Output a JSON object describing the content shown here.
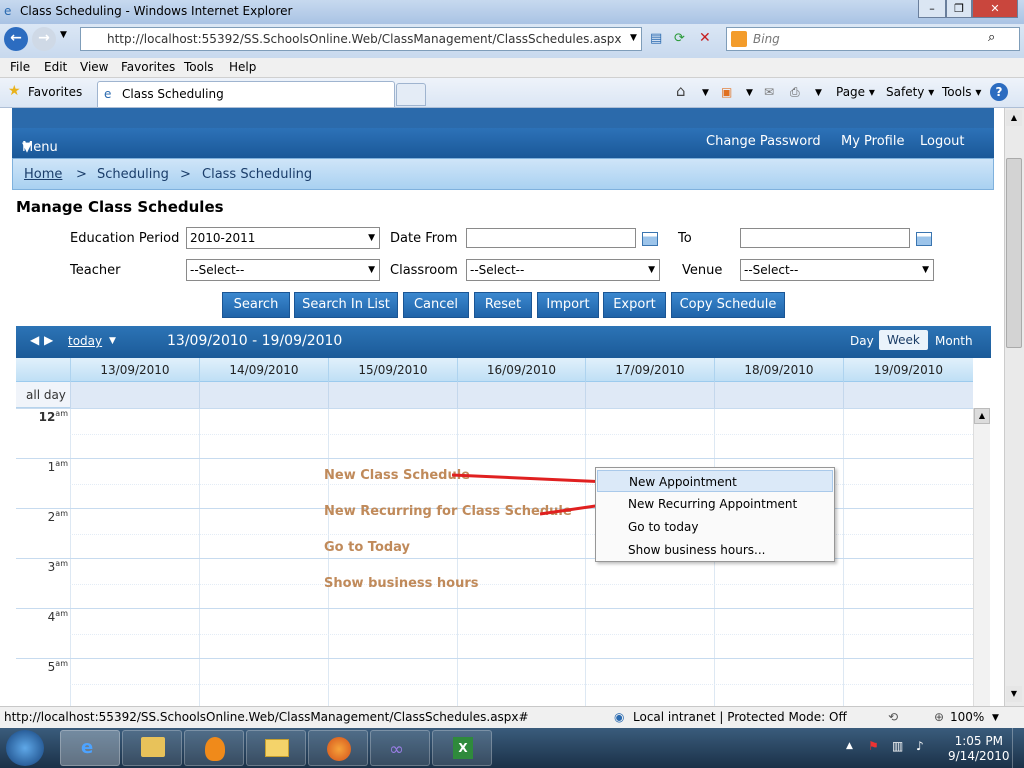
{
  "window": {
    "title": "Class Scheduling - Windows Internet Explorer"
  },
  "browser": {
    "address": "http://localhost:55392/SS.SchoolsOnline.Web/ClassManagement/ClassSchedules.aspx",
    "search_placeholder": "Bing",
    "menu": [
      "File",
      "Edit",
      "View",
      "Favorites",
      "Tools",
      "Help"
    ],
    "favorites_label": "Favorites",
    "tab_title": "Class Scheduling",
    "commands": {
      "page": "Page",
      "safety": "Safety",
      "tools": "Tools"
    }
  },
  "app": {
    "menu_label": "Menu",
    "links": {
      "change_password": "Change Password",
      "my_profile": "My Profile",
      "logout": "Logout"
    },
    "breadcrumb": {
      "home": "Home",
      "sep": ">",
      "scheduling": "Scheduling",
      "current": "Class Scheduling"
    },
    "heading": "Manage Class Schedules"
  },
  "filters": {
    "education_period_label": "Education Period",
    "education_period_value": "2010-2011",
    "date_from_label": "Date From",
    "to_label": "To",
    "teacher_label": "Teacher",
    "teacher_value": "--Select--",
    "classroom_label": "Classroom",
    "classroom_value": "--Select--",
    "venue_label": "Venue",
    "venue_value": "--Select--"
  },
  "buttons": [
    "Search",
    "Search In List",
    "Cancel",
    "Reset",
    "Import",
    "Export",
    "Copy Schedule"
  ],
  "scheduler": {
    "today": "today",
    "range": "13/09/2010 - 19/09/2010",
    "views": {
      "day": "Day",
      "week": "Week",
      "month": "Month"
    },
    "days": [
      "13/09/2010",
      "14/09/2010",
      "15/09/2010",
      "16/09/2010",
      "17/09/2010",
      "18/09/2010",
      "19/09/2010"
    ],
    "all_day": "all day",
    "hours": [
      "12",
      "1",
      "2",
      "3",
      "4",
      "5"
    ],
    "am": "am"
  },
  "annotations": [
    "New Class Schedule",
    "New Recurring for Class Schedule",
    "Go to Today",
    "Show business hours"
  ],
  "context_menu": [
    "New Appointment",
    "New Recurring Appointment",
    "Go to today",
    "Show business hours..."
  ],
  "status": {
    "url": "http://localhost:55392/SS.SchoolsOnline.Web/ClassManagement/ClassSchedules.aspx#",
    "zone": "Local intranet | Protected Mode: Off",
    "zoom": "100%"
  },
  "clock": {
    "time": "1:05 PM",
    "date": "9/14/2010"
  },
  "colors": {
    "brand_blue": "#1b5a98",
    "annotation": "#c08a5a",
    "arrow": "#e02020"
  }
}
